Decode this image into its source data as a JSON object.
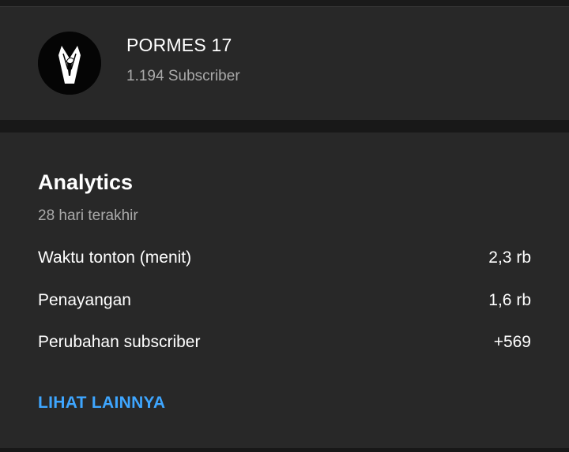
{
  "channel": {
    "avatar_icon": "tuxedo-figure-icon",
    "name": "PORMES 17",
    "subscribers": "1.194 Subscriber"
  },
  "analytics": {
    "title": "Analytics",
    "period": "28 hari terakhir",
    "metrics": [
      {
        "label": "Waktu tonton (menit)",
        "value": "2,3 rb"
      },
      {
        "label": "Penayangan",
        "value": "1,6 rb"
      },
      {
        "label": "Perubahan subscriber",
        "value": "+569"
      }
    ],
    "see_more_label": "LIHAT LAINNYA"
  },
  "colors": {
    "background": "#181818",
    "card": "#282828",
    "primary_text": "#ffffff",
    "secondary_text": "#aaaaaa",
    "link": "#3ea6ff"
  }
}
